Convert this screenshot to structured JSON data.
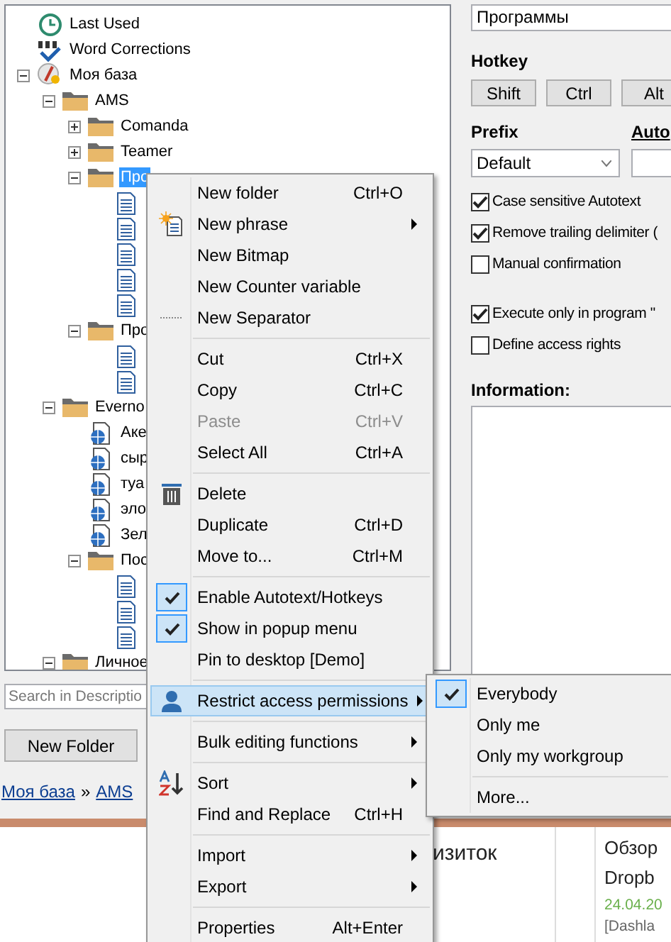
{
  "tree": [
    {
      "label": "Last Used",
      "kind": "recent",
      "selected": false
    },
    {
      "label": "Word Corrections",
      "kind": "corrections",
      "selected": false
    },
    {
      "label": "Моя база",
      "kind": "database",
      "expanded": true,
      "selected": false,
      "children": [
        {
          "label": "AMS",
          "kind": "folder",
          "expanded": true,
          "selected": false,
          "children": [
            {
              "label": "Comanda",
              "kind": "folder",
              "expanded": false,
              "selected": false
            },
            {
              "label": "Teamer",
              "kind": "folder",
              "expanded": false,
              "selected": false
            },
            {
              "label": "Про",
              "kind": "folder",
              "expanded": true,
              "selected": true,
              "children": [
                {
                  "kind": "document"
                },
                {
                  "kind": "document"
                },
                {
                  "kind": "document"
                },
                {
                  "kind": "document"
                },
                {
                  "kind": "document"
                }
              ]
            },
            {
              "label": "Про",
              "kind": "folder",
              "expanded": true,
              "selected": false,
              "children": [
                {
                  "kind": "document"
                },
                {
                  "kind": "document"
                }
              ]
            }
          ]
        },
        {
          "label": "Everno",
          "kind": "folder",
          "expanded": true,
          "selected": false,
          "children": [
            {
              "label": "Аке",
              "kind": "web-document"
            },
            {
              "label": "сыр",
              "kind": "web-document"
            },
            {
              "label": "туа",
              "kind": "web-document"
            },
            {
              "label": "эло",
              "kind": "web-document"
            },
            {
              "label": "Зел",
              "kind": "web-document"
            },
            {
              "label": "Пос",
              "kind": "folder",
              "expanded": true,
              "selected": false,
              "children": [
                {
                  "kind": "document"
                },
                {
                  "kind": "document"
                },
                {
                  "kind": "document"
                }
              ]
            }
          ]
        },
        {
          "label": "Личное",
          "kind": "folder",
          "expanded": true,
          "selected": false
        }
      ]
    }
  ],
  "search": {
    "placeholder": "Search in Descriptio"
  },
  "new_folder_button": "New Folder",
  "breadcrumb": [
    "Моя база",
    "AMS"
  ],
  "breadcrumb_separator": "»",
  "details": {
    "name_value": "Программы",
    "hotkey_label": "Hotkey",
    "hotkey_buttons": [
      "Shift",
      "Ctrl",
      "Alt"
    ],
    "prefix_label": "Prefix",
    "autotext_label": "Auto",
    "prefix_value": "Default",
    "options": [
      {
        "label": "Case sensitive Autotext",
        "checked": true
      },
      {
        "label": "Remove trailing delimiter (",
        "checked": true
      },
      {
        "label": "Manual confirmation",
        "checked": false
      }
    ],
    "program_options": [
      {
        "label": "Execute only in program \"",
        "checked": true
      },
      {
        "label": "Define access rights",
        "checked": false
      }
    ],
    "information_label": "Information:"
  },
  "bottom": {
    "column_2": "изиток",
    "column_4": [
      "Обзор",
      "Dropb"
    ],
    "date": "24.04.20",
    "source": "[Dashla"
  },
  "context_menu": [
    {
      "kind": "item",
      "label": "New folder",
      "shortcut": "Ctrl+O",
      "submenu": false,
      "disabled": false,
      "checked": false,
      "selected": false
    },
    {
      "kind": "item",
      "label": "New phrase",
      "submenu": true,
      "disabled": false,
      "checked": false,
      "selected": false
    },
    {
      "kind": "item",
      "label": "New Bitmap",
      "submenu": false,
      "disabled": false,
      "checked": false,
      "selected": false
    },
    {
      "kind": "item",
      "label": "New Counter variable",
      "submenu": false,
      "disabled": false,
      "checked": false,
      "selected": false
    },
    {
      "kind": "item",
      "label": "New Separator",
      "submenu": false,
      "disabled": false,
      "checked": false,
      "selected": false
    },
    {
      "kind": "separator"
    },
    {
      "kind": "item",
      "label": "Cut",
      "shortcut": "Ctrl+X",
      "submenu": false,
      "disabled": false,
      "checked": false,
      "selected": false
    },
    {
      "kind": "item",
      "label": "Copy",
      "shortcut": "Ctrl+C",
      "submenu": false,
      "disabled": false,
      "checked": false,
      "selected": false
    },
    {
      "kind": "item",
      "label": "Paste",
      "shortcut": "Ctrl+V",
      "submenu": false,
      "disabled": true,
      "checked": false,
      "selected": false
    },
    {
      "kind": "item",
      "label": "Select All",
      "shortcut": "Ctrl+A",
      "submenu": false,
      "disabled": false,
      "checked": false,
      "selected": false
    },
    {
      "kind": "separator"
    },
    {
      "kind": "item",
      "label": "Delete",
      "submenu": false,
      "disabled": false,
      "checked": false,
      "selected": false
    },
    {
      "kind": "item",
      "label": "Duplicate",
      "shortcut": "Ctrl+D",
      "submenu": false,
      "disabled": false,
      "checked": false,
      "selected": false
    },
    {
      "kind": "item",
      "label": "Move to...",
      "shortcut": "Ctrl+M",
      "submenu": false,
      "disabled": false,
      "checked": false,
      "selected": false
    },
    {
      "kind": "separator"
    },
    {
      "kind": "item",
      "label": "Enable Autotext/Hotkeys",
      "submenu": false,
      "disabled": false,
      "checked": true,
      "selected": false
    },
    {
      "kind": "item",
      "label": "Show in popup menu",
      "submenu": false,
      "disabled": false,
      "checked": true,
      "selected": false
    },
    {
      "kind": "item",
      "label": "Pin to desktop [Demo]",
      "submenu": false,
      "disabled": false,
      "checked": false,
      "selected": false
    },
    {
      "kind": "separator"
    },
    {
      "kind": "item",
      "label": "Restrict access permissions",
      "submenu": true,
      "disabled": false,
      "checked": false,
      "selected": true
    },
    {
      "kind": "separator"
    },
    {
      "kind": "item",
      "label": "Bulk editing functions",
      "submenu": true,
      "disabled": false,
      "checked": false,
      "selected": false
    },
    {
      "kind": "separator"
    },
    {
      "kind": "item",
      "label": "Sort",
      "submenu": true,
      "disabled": false,
      "checked": false,
      "selected": false
    },
    {
      "kind": "item",
      "label": "Find and Replace",
      "shortcut": "Ctrl+H",
      "submenu": false,
      "disabled": false,
      "checked": false,
      "selected": false
    },
    {
      "kind": "separator"
    },
    {
      "kind": "item",
      "label": "Import",
      "submenu": true,
      "disabled": false,
      "checked": false,
      "selected": false
    },
    {
      "kind": "item",
      "label": "Export",
      "submenu": true,
      "disabled": false,
      "checked": false,
      "selected": false
    },
    {
      "kind": "separator"
    },
    {
      "kind": "item",
      "label": "Properties",
      "shortcut": "Alt+Enter",
      "submenu": false,
      "disabled": false,
      "checked": false,
      "selected": false
    }
  ],
  "submenu": [
    {
      "kind": "item",
      "label": "Everybody",
      "checked": true
    },
    {
      "kind": "item",
      "label": "Only me",
      "checked": false
    },
    {
      "kind": "item",
      "label": "Only my workgroup",
      "checked": false
    },
    {
      "kind": "separator"
    },
    {
      "kind": "item",
      "label": "More...",
      "checked": false
    }
  ]
}
